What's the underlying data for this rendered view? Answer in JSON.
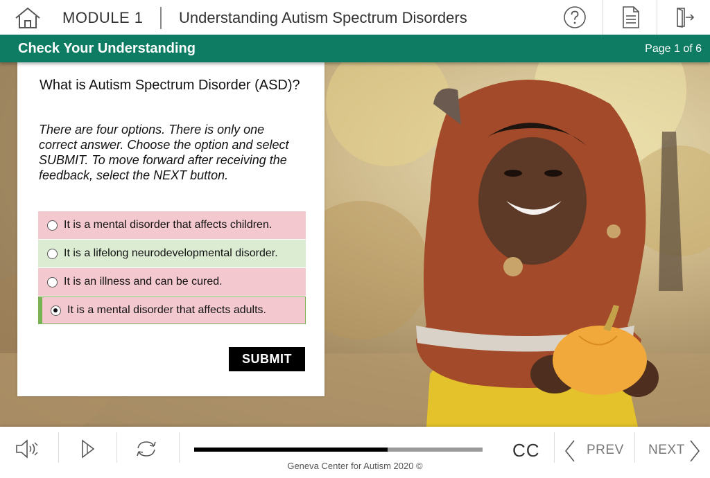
{
  "header": {
    "module": "MODULE 1",
    "course_title": "Understanding Autism Spectrum Disorders",
    "icons": [
      "home-icon",
      "help-icon",
      "document-icon",
      "exit-icon"
    ]
  },
  "section": {
    "title": "Check Your Understanding",
    "page_indicator": "Page 1 of 6",
    "color": "#0e7c63"
  },
  "quiz": {
    "question": "What is Autism Spectrum Disorder (ASD)?",
    "instructions": "There are four options. There is only one correct answer. Choose the option and select SUBMIT. To move forward after receiving the feedback, select the NEXT button.",
    "options": [
      {
        "label": "It is a mental disorder that affects children.",
        "state": "incorrect"
      },
      {
        "label": "It is a lifelong neurodevelopmental disorder.",
        "state": "correct"
      },
      {
        "label": "It is an illness and can be cured.",
        "state": "incorrect"
      },
      {
        "label": "It is a mental disorder that affects adults.",
        "state": "incorrect-selected"
      }
    ],
    "submit_label": "SUBMIT",
    "colors": {
      "incorrect": "#f3c9cf",
      "correct": "#dcecd3",
      "selected_border": "#79b255"
    }
  },
  "player": {
    "progress": 0.67,
    "cc_label": "CC",
    "prev_label": "PREV",
    "next_label": "NEXT",
    "footer": "Geneva Center for Autism 2020 ©",
    "icons": [
      "audio-icon",
      "play-icon",
      "replay-icon",
      "chevron-left-icon",
      "chevron-right-icon"
    ]
  }
}
